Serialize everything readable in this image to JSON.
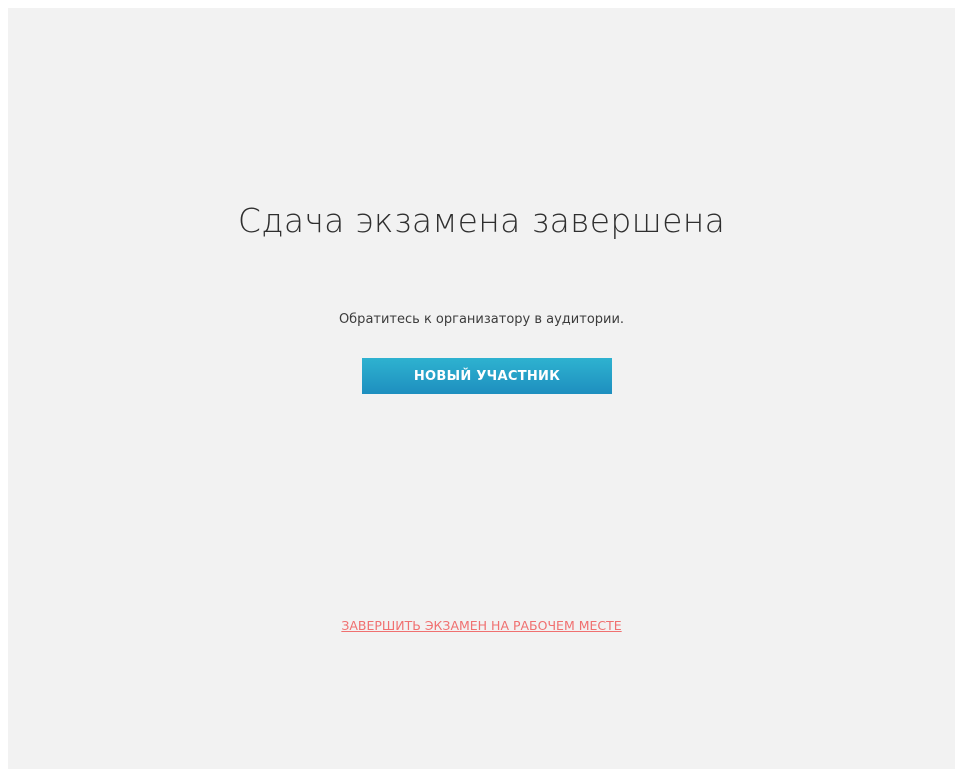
{
  "main": {
    "title": "Сдача экзамена завершена",
    "message": "Обратитесь к организатору в аудитории.",
    "new_participant_label": "НОВЫЙ УЧАСТНИК",
    "finish_exam_link": "ЗАВЕРШИТЬ ЭКЗАМЕН НА РАБОЧЕМ МЕСТЕ"
  },
  "colors": {
    "background": "#f2f2f2",
    "button_top": "#2eb2d0",
    "button_bottom": "#1e8fbf",
    "link": "#f07070",
    "title_text": "#2f2f2f"
  }
}
